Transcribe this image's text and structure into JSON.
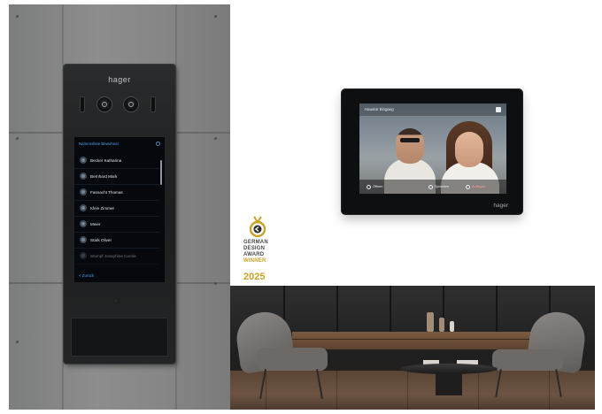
{
  "door_station": {
    "brand": "hager",
    "header": "Namensliste Bewohner",
    "entries": [
      "Becker Katharina",
      "Bernhard Mark",
      "Fasnacht Thomas",
      "Klein Zimmer",
      "Meier",
      "Stark Oliver",
      "Stumpf Josephine Carola"
    ],
    "footer": "< Zurück"
  },
  "indoor_monitor": {
    "brand": "hager",
    "screen_top_label": "Haustür Eingang",
    "buttons": [
      "Öffnen",
      "Sprechen",
      "Auflegen"
    ]
  },
  "award": {
    "lines": [
      "GERMAN",
      "DESIGN",
      "AWARD",
      "WINNER"
    ],
    "year": "2025"
  },
  "colors": {
    "award_gold": "#c9a227",
    "screen_accent": "#4fa3f2",
    "metal_wall": "#858685"
  }
}
